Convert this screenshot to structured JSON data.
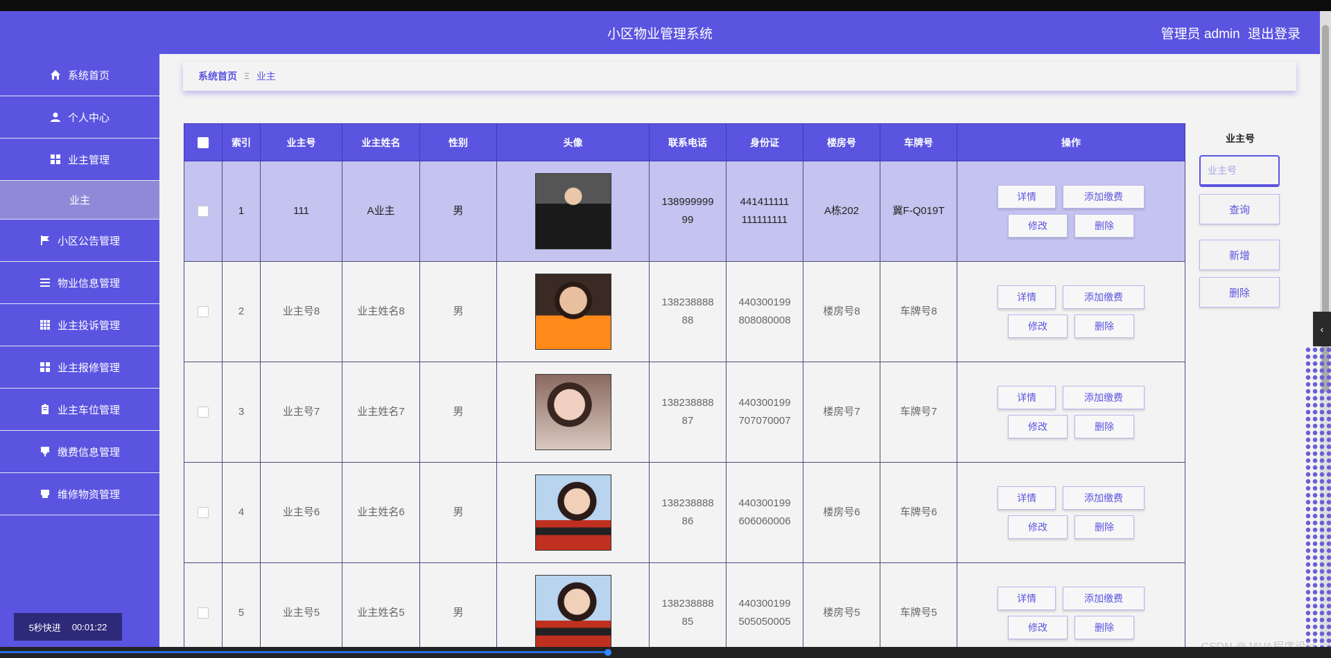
{
  "header": {
    "title": "小区物业管理系统",
    "user": "管理员 admin",
    "logout": "退出登录"
  },
  "sidebar": {
    "items": [
      {
        "label": "系统首页",
        "icon": "home-icon"
      },
      {
        "label": "个人中心",
        "icon": "user-icon"
      },
      {
        "label": "业主管理",
        "icon": "grid-icon"
      },
      {
        "label": "业主",
        "icon": ""
      },
      {
        "label": "小区公告管理",
        "icon": "flag-icon"
      },
      {
        "label": "物业信息管理",
        "icon": "list-icon"
      },
      {
        "label": "业主投诉管理",
        "icon": "grid9-icon"
      },
      {
        "label": "业主报修管理",
        "icon": "grid-icon"
      },
      {
        "label": "业主车位管理",
        "icon": "clipboard-icon"
      },
      {
        "label": "缴费信息管理",
        "icon": "payment-icon"
      },
      {
        "label": "维修物资管理",
        "icon": "printer-icon"
      }
    ],
    "timer": {
      "label": "5秒快进",
      "time": "00:01:22"
    }
  },
  "breadcrumb": {
    "home": "系统首页",
    "sep": "Ξ",
    "current": "业主"
  },
  "table": {
    "headers": [
      "索引",
      "业主号",
      "业主姓名",
      "性别",
      "头像",
      "联系电话",
      "身份证",
      "楼房号",
      "车牌号",
      "操作"
    ],
    "rows": [
      {
        "index": "1",
        "owner_no": "111",
        "name": "A业主",
        "gender": "男",
        "phone": [
          "138999999",
          "99"
        ],
        "id_card": [
          "441411111",
          "111111111"
        ],
        "building": "A栋202",
        "plate": "冀F-Q019T"
      },
      {
        "index": "2",
        "owner_no": "业主号8",
        "name": "业主姓名8",
        "gender": "男",
        "phone": [
          "138238888",
          "88"
        ],
        "id_card": [
          "440300199",
          "808080008"
        ],
        "building": "楼房号8",
        "plate": "车牌号8"
      },
      {
        "index": "3",
        "owner_no": "业主号7",
        "name": "业主姓名7",
        "gender": "男",
        "phone": [
          "138238888",
          "87"
        ],
        "id_card": [
          "440300199",
          "707070007"
        ],
        "building": "楼房号7",
        "plate": "车牌号7"
      },
      {
        "index": "4",
        "owner_no": "业主号6",
        "name": "业主姓名6",
        "gender": "男",
        "phone": [
          "138238888",
          "86"
        ],
        "id_card": [
          "440300199",
          "606060006"
        ],
        "building": "楼房号6",
        "plate": "车牌号6"
      },
      {
        "index": "5",
        "owner_no": "业主号5",
        "name": "业主姓名5",
        "gender": "男",
        "phone": [
          "138238888",
          "85"
        ],
        "id_card": [
          "440300199",
          "505050005"
        ],
        "building": "楼房号5",
        "plate": "车牌号5"
      }
    ],
    "actions": {
      "detail": "详情",
      "add_fee": "添加缴费",
      "edit": "修改",
      "delete": "删除"
    }
  },
  "search": {
    "label": "业主号",
    "placeholder": "业主号",
    "query": "查询",
    "add": "新增",
    "delete": "删除"
  },
  "watermark": "CSDN @JAVA程序设计",
  "colors": {
    "primary": "#5b54e0",
    "selected_row": "#c5c3ef"
  }
}
